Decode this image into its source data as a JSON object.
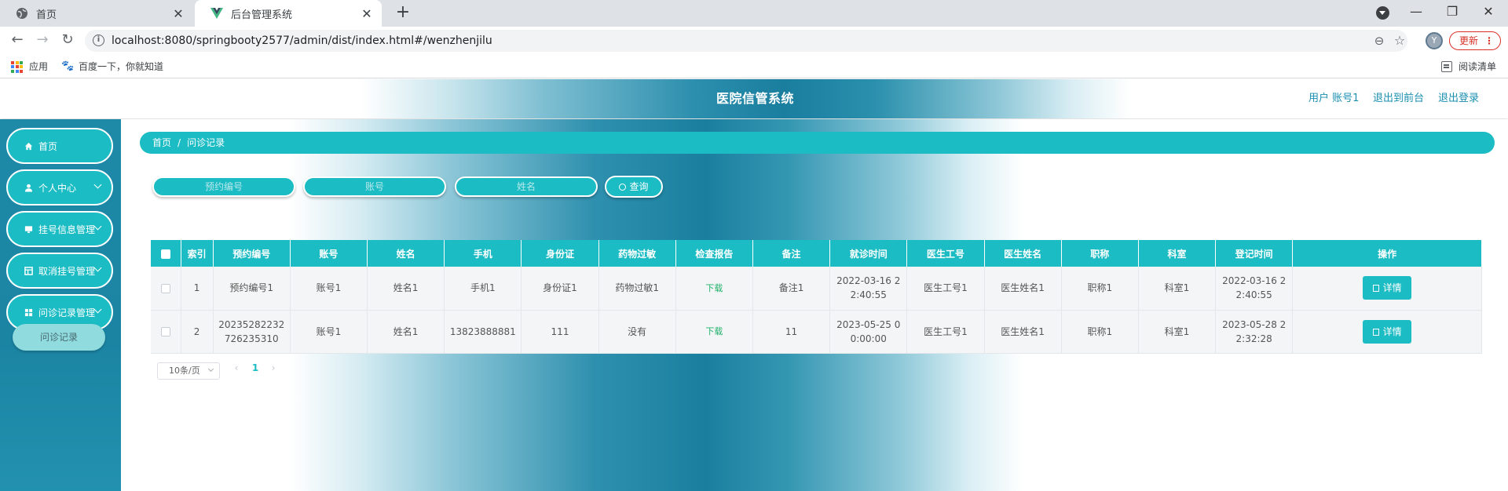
{
  "browser": {
    "tabs": [
      {
        "title": "首页",
        "close": "✕"
      },
      {
        "title": "后台管理系统",
        "close": "✕"
      }
    ],
    "newtab": "+",
    "window_controls": {
      "minimize": "—",
      "restore": "❐",
      "close": "✕"
    },
    "url": "localhost:8080/springbooty2577/admin/dist/index.html#/wenzhenjilu",
    "update_label": "更新",
    "kebab": "⋮",
    "bookmarks": [
      {
        "label": "应用"
      },
      {
        "label": "百度一下，你就知道"
      }
    ],
    "reading_list": "阅读清单",
    "apps_colors": [
      "#ea4335",
      "#fbbc05",
      "#34a853",
      "#4285f4",
      "#ea4335",
      "#fbbc05",
      "#34a853",
      "#4285f4",
      "#ea4335"
    ]
  },
  "header": {
    "title": "医院信管系统",
    "user_label": "用户 账号1",
    "front_label": "退出到前台",
    "logout_label": "退出登录"
  },
  "sidebar": {
    "items": [
      {
        "label": "首页",
        "icon": "home-icon"
      },
      {
        "label": "个人中心",
        "icon": "user-icon"
      },
      {
        "label": "挂号信息管理",
        "icon": "monitor-icon"
      },
      {
        "label": "取消挂号管理",
        "icon": "table-icon"
      },
      {
        "label": "问诊记录管理",
        "icon": "grid-icon"
      }
    ],
    "active_sub": "问诊记录"
  },
  "breadcrumb": {
    "home": "首页",
    "sep": "/",
    "current": "问诊记录"
  },
  "search": {
    "booking_placeholder": "预约编号",
    "account_placeholder": "账号",
    "name_placeholder": "姓名",
    "query_label": "查询"
  },
  "table": {
    "headers": [
      "索引",
      "预约编号",
      "账号",
      "姓名",
      "手机",
      "身份证",
      "药物过敏",
      "检查报告",
      "备注",
      "就诊时间",
      "医生工号",
      "医生姓名",
      "职称",
      "科室",
      "登记时间",
      "操作"
    ],
    "rows": [
      {
        "index": "1",
        "booking": "预约编号1",
        "account": "账号1",
        "name": "姓名1",
        "phone": "手机1",
        "id_card": "身份证1",
        "allergy": "药物过敏1",
        "report": "下载",
        "note": "备注1",
        "visit_time": "2022-03-16 22:40:55",
        "doctor_id": "医生工号1",
        "doctor_name": "医生姓名1",
        "title": "职称1",
        "dept": "科室1",
        "reg_time": "2022-03-16 22:40:55",
        "action": "详情"
      },
      {
        "index": "2",
        "booking": "20235282232726235310",
        "account": "账号1",
        "name": "姓名1",
        "phone": "13823888881",
        "id_card": "111",
        "allergy": "没有",
        "report": "下载",
        "note": "11",
        "visit_time": "2023-05-25 00:00:00",
        "doctor_id": "医生工号1",
        "doctor_name": "医生姓名1",
        "title": "职称1",
        "dept": "科室1",
        "reg_time": "2023-05-28 22:32:28",
        "action": "详情"
      }
    ]
  },
  "pagination": {
    "page_size": "10条/页",
    "current_page": "1",
    "prev": "‹",
    "next": "›"
  },
  "colors": {
    "accent": "#1cbcc4",
    "sidebar_bg": "#1e8aa8",
    "download_green": "#1fb26a"
  }
}
